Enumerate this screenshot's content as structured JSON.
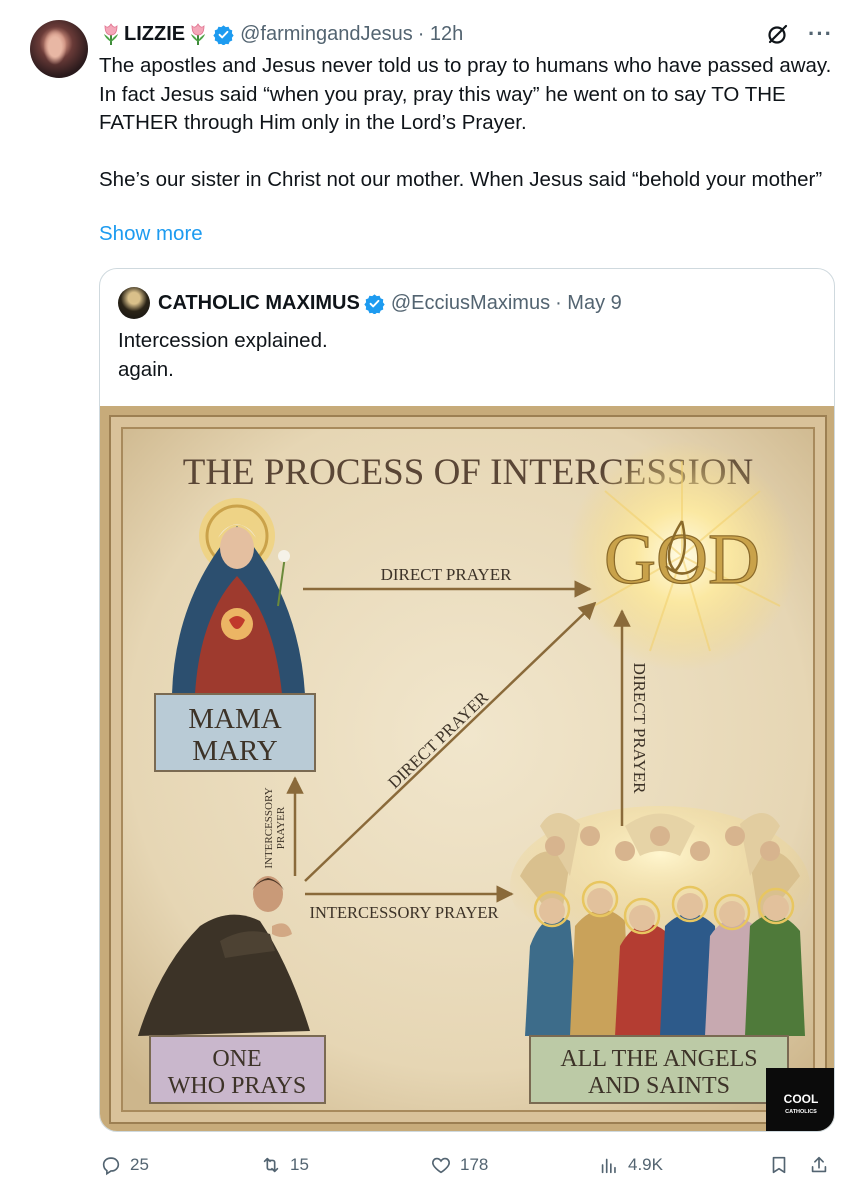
{
  "tweet": {
    "display_name": "LIZZIE",
    "handle": "@farmingandJesus",
    "time": "· 12h",
    "paragraph1": "The apostles and Jesus never told us to pray to humans who have passed away. In fact Jesus said “when you pray, pray this way” he went on to say TO THE FATHER through Him only in the Lord’s Prayer.",
    "paragraph2": "She’s our sister in Christ not our mother. When Jesus said “behold your mother”",
    "show_more": "Show more"
  },
  "quote": {
    "display_name": "CATHOLIC MAXIMUS",
    "handle": "@EcciusMaximus",
    "time": "· May 9",
    "line1": "Intercession explained.",
    "line2": "again."
  },
  "graphic": {
    "title": "THE PROCESS OF INTERCESSION",
    "god": "GOD",
    "mary_line1": "MAMA",
    "mary_line2": "MARY",
    "prays_line1": "ONE",
    "prays_line2": "WHO PRAYS",
    "saints_line1": "ALL THE ANGELS",
    "saints_line2": "AND SAINTS",
    "arrow_mary_god": "DIRECT PRAYER",
    "arrow_diagonal": "DIRECT PRAYER",
    "arrow_saints_god": "DIRECT PRAYER",
    "arrow_prays_saints": "INTERCESSORY PRAYER",
    "arrow_prays_mary_1": "INTERCESSORY",
    "arrow_prays_mary_2": "PRAYER",
    "watermark_1": "COOL",
    "watermark_2": "CATHOLICS"
  },
  "actions": {
    "replies": "25",
    "reposts": "15",
    "likes": "178",
    "views": "4.9K"
  },
  "colors": {
    "link": "#1d9bf0",
    "secondary_text": "#536471",
    "verified": "#1d9bf0",
    "parchment": "#e9dcc0",
    "frame": "#b89b6c"
  }
}
